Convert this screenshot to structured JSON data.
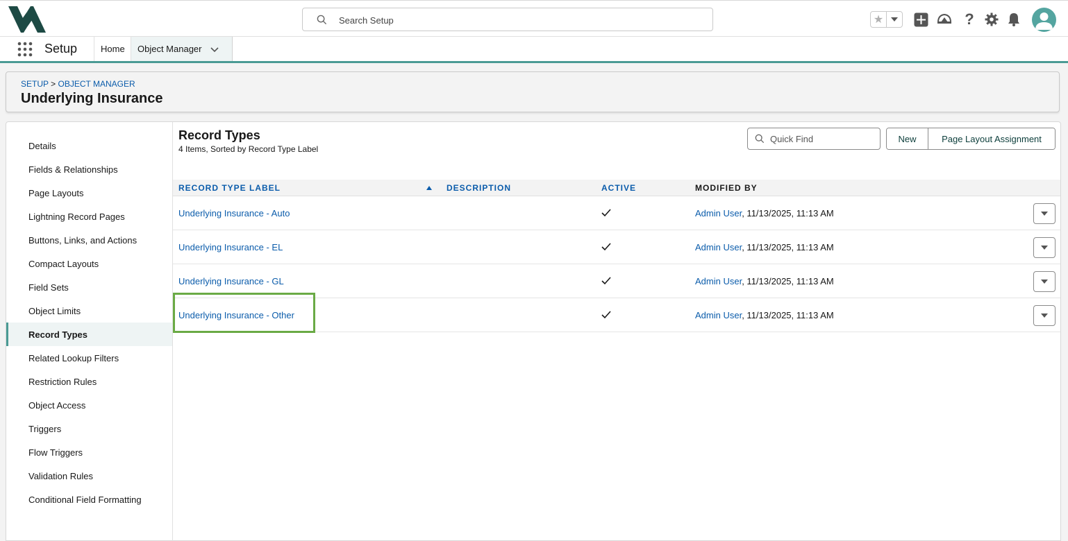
{
  "header": {
    "search_placeholder": "Search Setup",
    "icons": [
      "favorites-star-icon",
      "favorites-dropdown-icon",
      "global-actions-plus-icon",
      "trailhead-icon",
      "help-icon",
      "setup-gear-icon",
      "notifications-bell-icon",
      "user-avatar-icon"
    ]
  },
  "nav": {
    "app_name": "Setup",
    "tabs": [
      {
        "label": "Home"
      },
      {
        "label": "Object Manager"
      }
    ]
  },
  "page": {
    "breadcrumb_setup": "SETUP",
    "breadcrumb_separator": ">",
    "breadcrumb_object_manager": "OBJECT MANAGER",
    "title": "Underlying Insurance"
  },
  "sidebar": {
    "items": [
      {
        "label": "Details"
      },
      {
        "label": "Fields & Relationships"
      },
      {
        "label": "Page Layouts"
      },
      {
        "label": "Lightning Record Pages"
      },
      {
        "label": "Buttons, Links, and Actions"
      },
      {
        "label": "Compact Layouts"
      },
      {
        "label": "Field Sets"
      },
      {
        "label": "Object Limits"
      },
      {
        "label": "Record Types",
        "active": true
      },
      {
        "label": "Related Lookup Filters"
      },
      {
        "label": "Restriction Rules"
      },
      {
        "label": "Object Access"
      },
      {
        "label": "Triggers"
      },
      {
        "label": "Flow Triggers"
      },
      {
        "label": "Validation Rules"
      },
      {
        "label": "Conditional Field Formatting"
      }
    ]
  },
  "record_types": {
    "title": "Record Types",
    "subtitle": "4 Items, Sorted by Record Type Label",
    "quick_find_placeholder": "Quick Find",
    "new_button": "New",
    "page_layout_assignment_button": "Page Layout Assignment",
    "columns": {
      "label": "RECORD TYPE LABEL",
      "description": "DESCRIPTION",
      "active": "ACTIVE",
      "modified_by": "MODIFIED BY"
    },
    "rows": [
      {
        "label": "Underlying Insurance - Auto",
        "description": "",
        "active": true,
        "modified_user": "Admin User",
        "modified_rest": ", 11/13/2025, 11:13 AM"
      },
      {
        "label": "Underlying Insurance - EL",
        "description": "",
        "active": true,
        "modified_user": "Admin User",
        "modified_rest": ", 11/13/2025, 11:13 AM"
      },
      {
        "label": "Underlying Insurance - GL",
        "description": "",
        "active": true,
        "modified_user": "Admin User",
        "modified_rest": ", 11/13/2025, 11:13 AM"
      },
      {
        "label": "Underlying Insurance - Other",
        "description": "",
        "active": true,
        "modified_user": "Admin User",
        "modified_rest": ", 11/13/2025, 11:13 AM"
      }
    ]
  },
  "colors": {
    "link": "#0b5cab",
    "accent_teal": "#4a9a94",
    "highlight_green": "#6aaa45"
  }
}
